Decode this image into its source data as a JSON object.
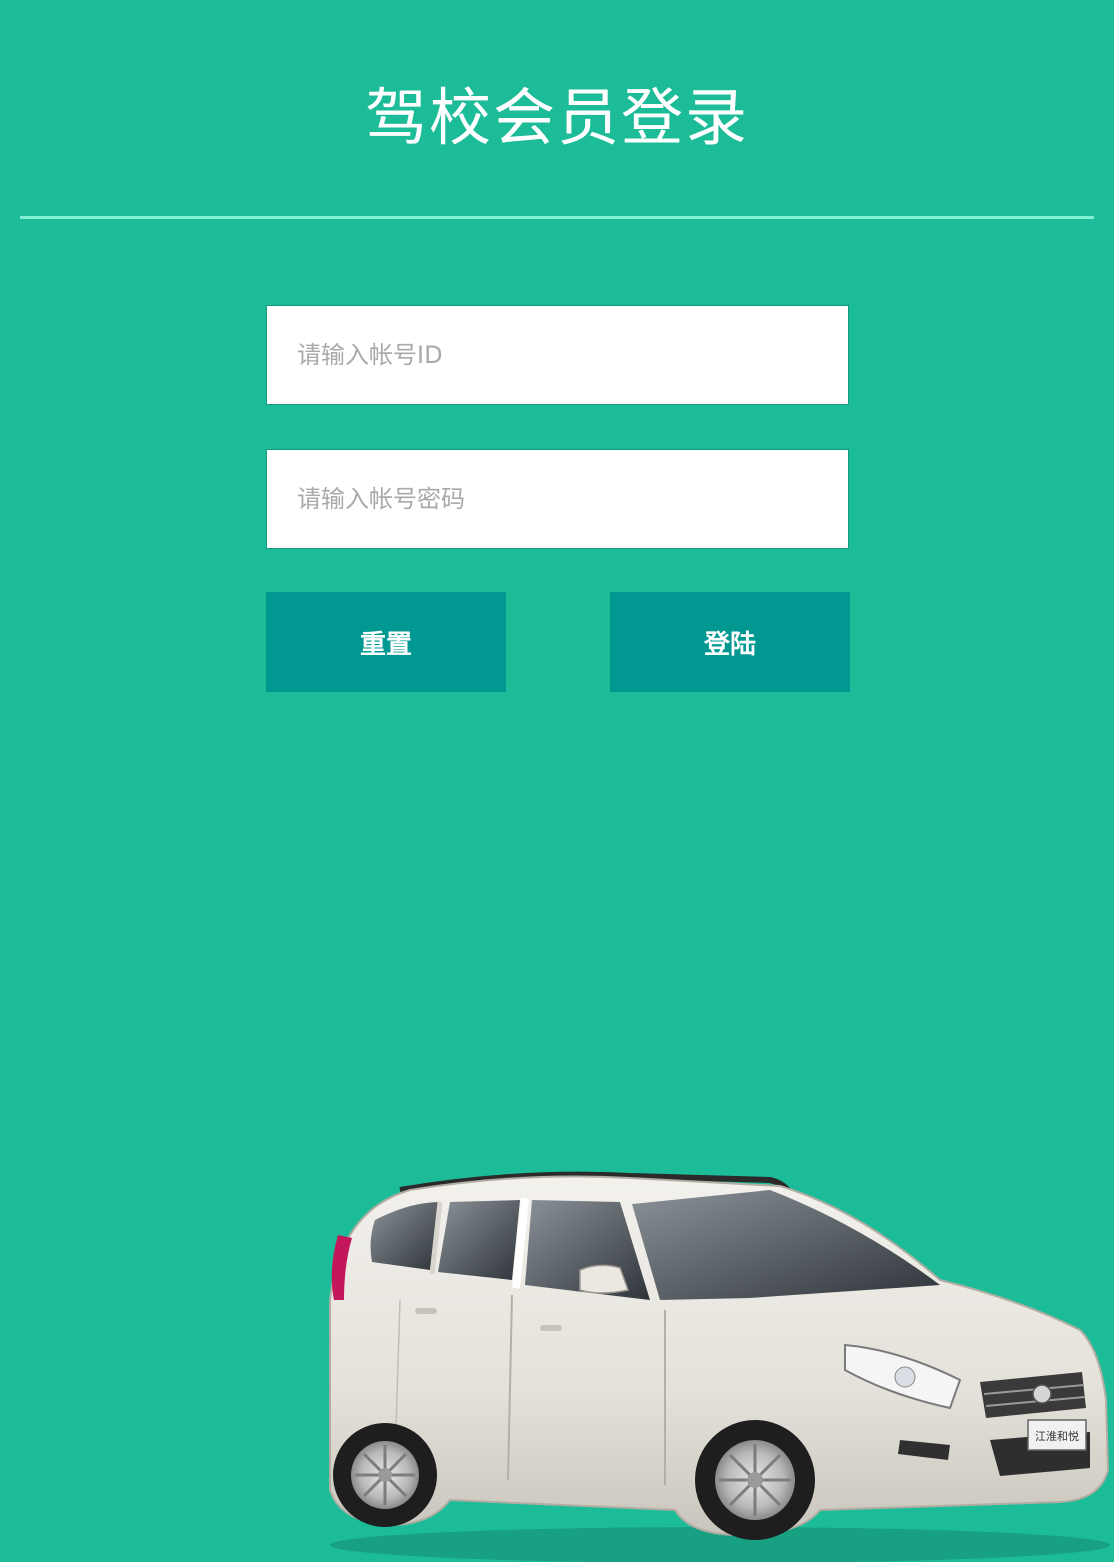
{
  "header": {
    "title": "驾校会员登录"
  },
  "form": {
    "account_placeholder": "请输入帐号ID",
    "password_placeholder": "请输入帐号密码",
    "reset_label": "重置",
    "login_label": "登陆"
  },
  "colors": {
    "background": "#1dbc98",
    "divider": "#7ff0d4",
    "button": "#009891"
  },
  "illustration": {
    "car_badge": "江淮和悦"
  }
}
